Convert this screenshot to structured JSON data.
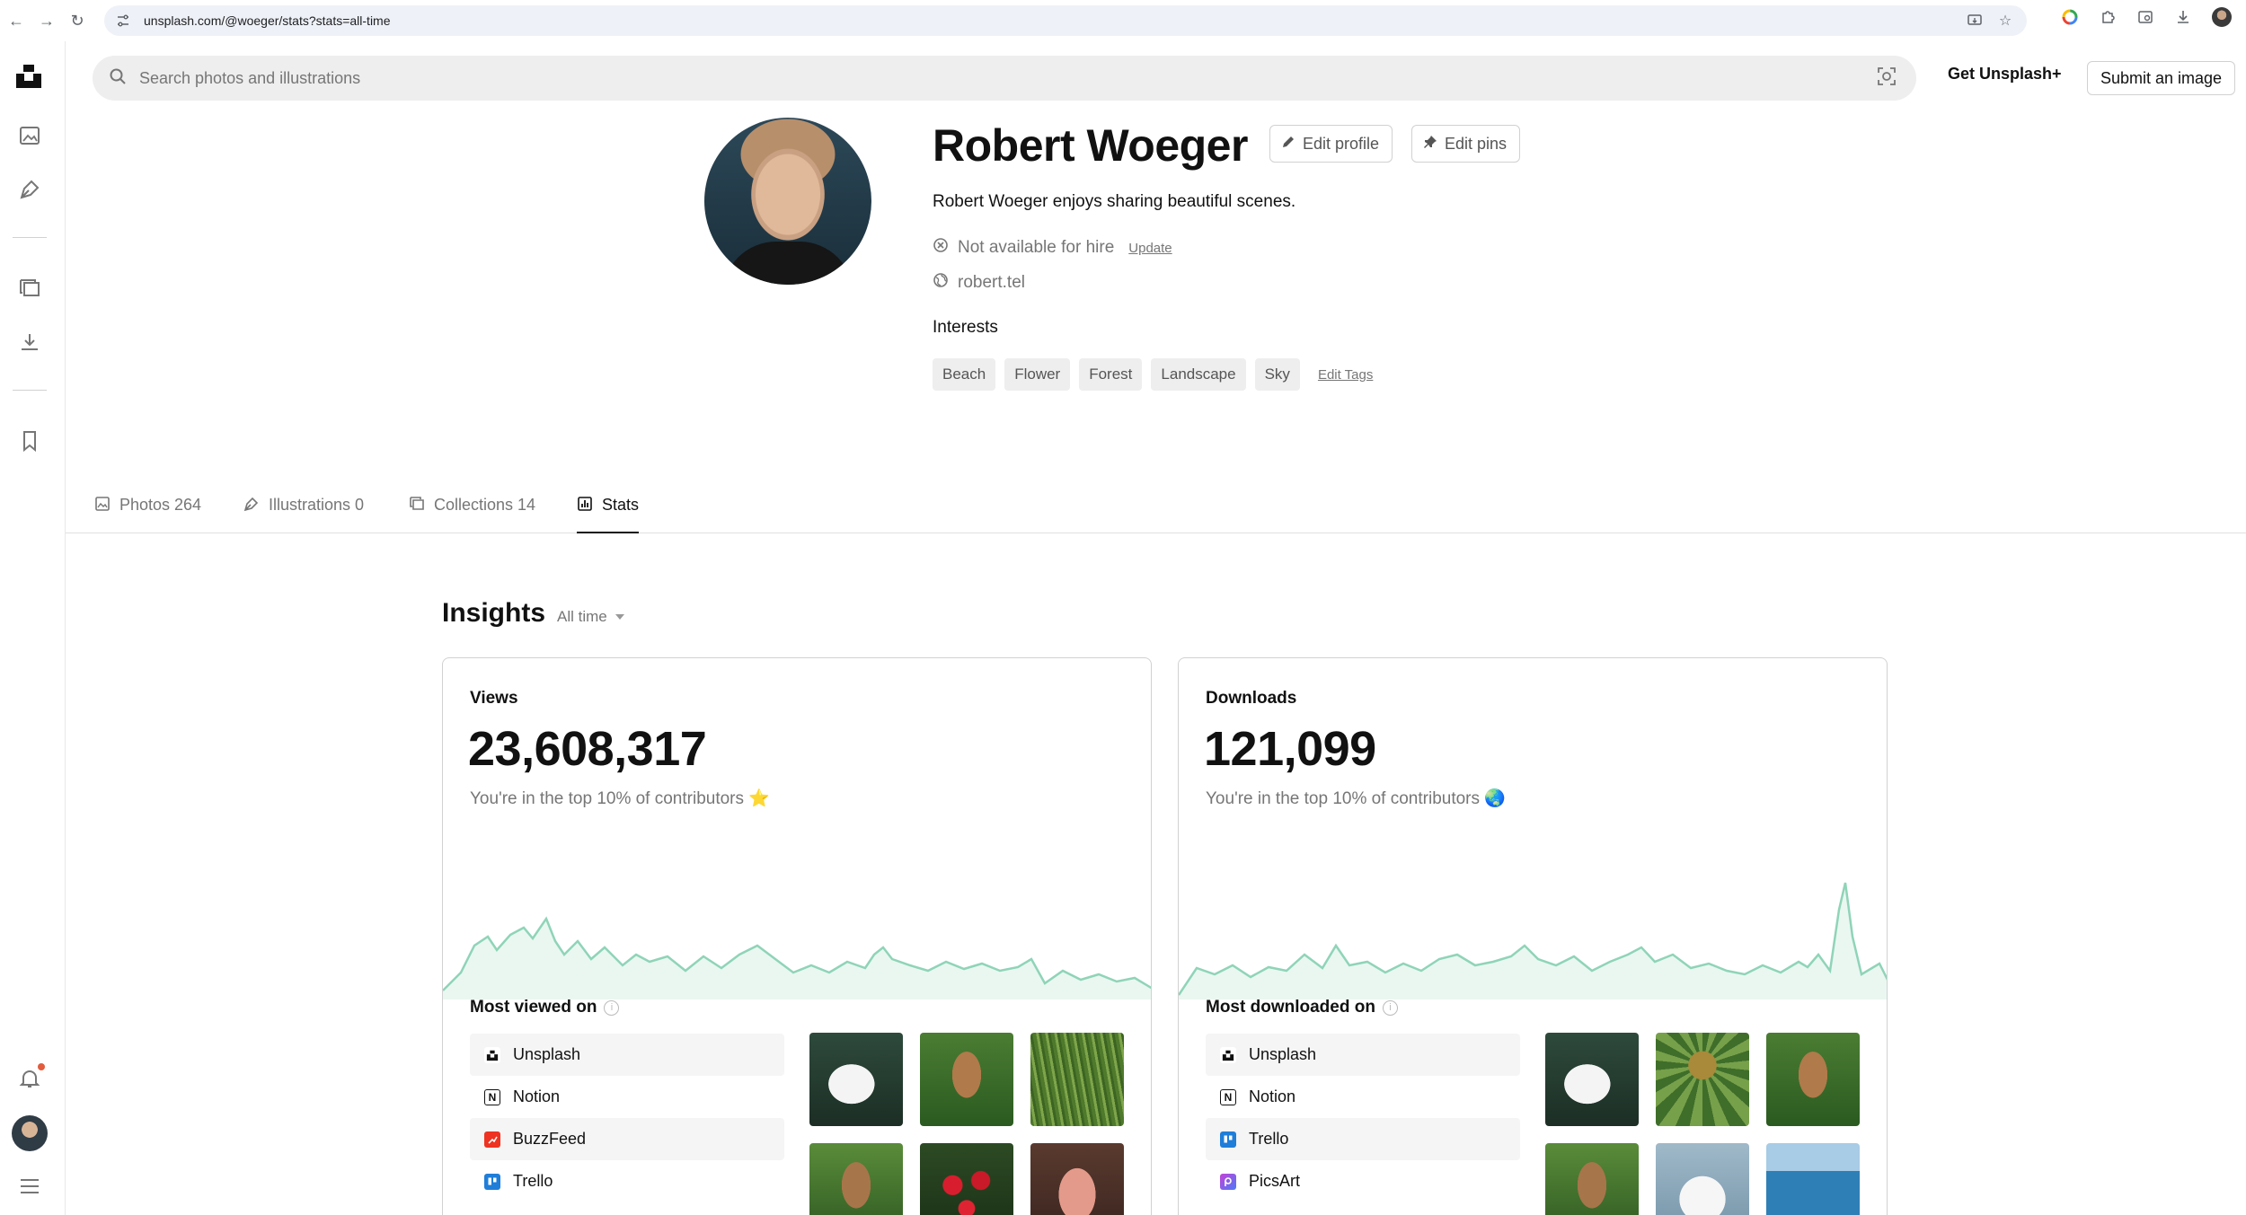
{
  "browser": {
    "url": "unsplash.com/@woeger/stats?stats=all-time"
  },
  "header": {
    "search_placeholder": "Search photos and illustrations",
    "get_plus": "Get Unsplash+",
    "submit": "Submit an image"
  },
  "profile": {
    "name": "Robert Woeger",
    "edit_profile": "Edit profile",
    "edit_pins": "Edit pins",
    "bio": "Robert Woeger enjoys sharing beautiful scenes.",
    "hire_status": "Not available for hire",
    "update": "Update",
    "website": "robert.tel",
    "interests_title": "Interests",
    "tags": [
      "Beach",
      "Flower",
      "Forest",
      "Landscape",
      "Sky"
    ],
    "edit_tags": "Edit Tags"
  },
  "tabs": [
    {
      "label": "Photos 264",
      "icon": "image-icon"
    },
    {
      "label": "Illustrations 0",
      "icon": "pen-icon"
    },
    {
      "label": "Collections 14",
      "icon": "collections-icon"
    },
    {
      "label": "Stats",
      "icon": "stats-icon",
      "active": true
    }
  ],
  "insights": {
    "title": "Insights",
    "range": "All time",
    "views": {
      "title": "Views",
      "value": "23,608,317",
      "note": "You're in the top 10% of contributors ⭐",
      "most_title": "Most viewed on",
      "platforms": [
        "Unsplash",
        "Notion",
        "BuzzFeed",
        "Trello"
      ]
    },
    "downloads": {
      "title": "Downloads",
      "value": "121,099",
      "note": "You're in the top 10% of contributors 🌏",
      "most_title": "Most downloaded on",
      "platforms": [
        "Unsplash",
        "Notion",
        "Trello",
        "PicsArt"
      ]
    }
  },
  "colors": {
    "spark_line": "#8fd4b8",
    "spark_fill": "#eaf7f1",
    "accent_text": "#111111",
    "muted_text": "#767676"
  }
}
